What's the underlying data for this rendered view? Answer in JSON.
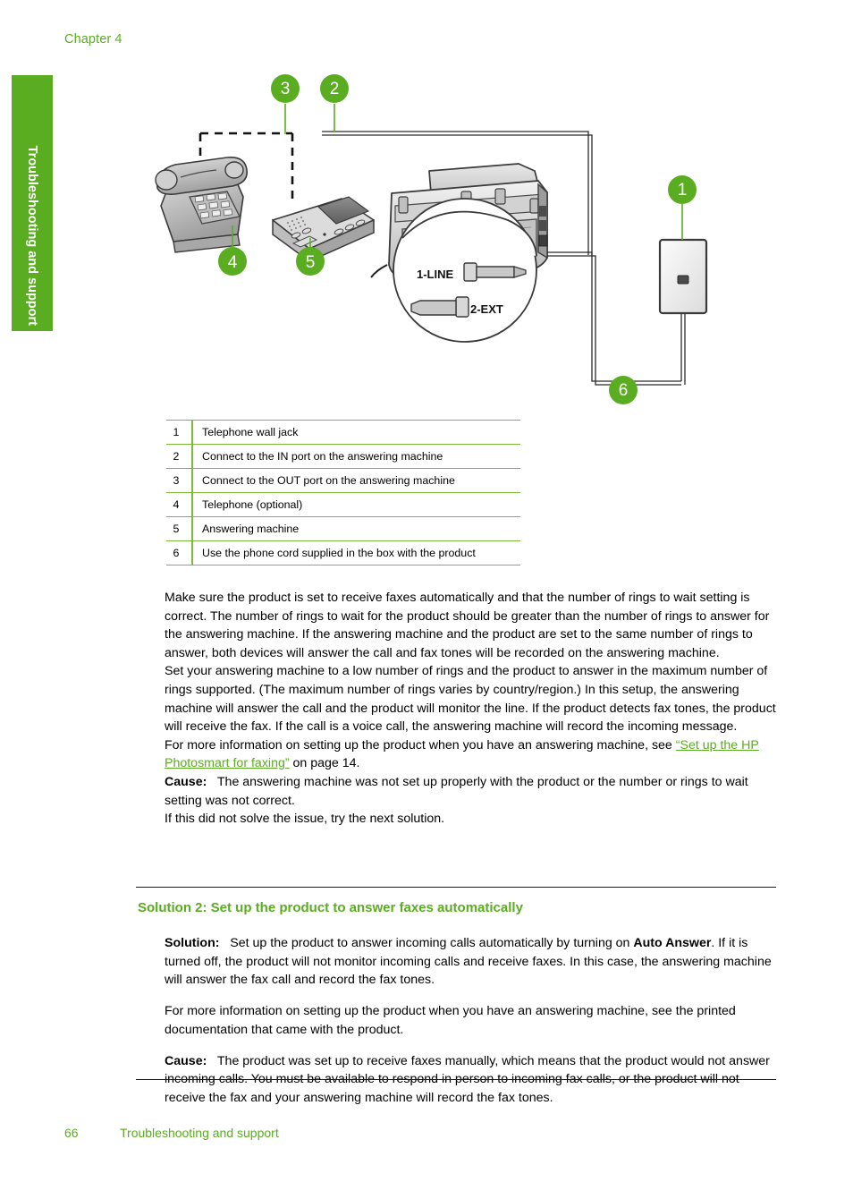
{
  "chapter": {
    "label": "Chapter 4"
  },
  "side_tab": {
    "label": "Troubleshooting and support"
  },
  "figure": {
    "callouts": [
      {
        "id": "1",
        "number": "1"
      },
      {
        "id": "2",
        "number": "2"
      },
      {
        "id": "3",
        "number": "3"
      },
      {
        "id": "4",
        "number": "4"
      },
      {
        "id": "5",
        "number": "5"
      },
      {
        "id": "6",
        "number": "6"
      }
    ],
    "port_labels": {
      "line": "1-LINE",
      "ext": "2-EXT"
    },
    "accent_color": "#5aad20"
  },
  "legend": {
    "rows": [
      {
        "num": "1",
        "text": "Telephone wall jack"
      },
      {
        "num": "2",
        "text": "Connect to the IN port on the answering machine"
      },
      {
        "num": "3",
        "text": "Connect to the OUT port on the answering machine"
      },
      {
        "num": "4",
        "text": "Telephone (optional)"
      },
      {
        "num": "5",
        "text": "Answering machine"
      },
      {
        "num": "6",
        "text": "Use the phone cord supplied in the box with the product"
      }
    ]
  },
  "body": {
    "p1": "Make sure the product is set to receive faxes automatically and that the number of rings to wait setting is correct. The number of rings to wait for the product should be greater than the number of rings to answer for the answering machine. If the answering machine and the product are set to the same number of rings to answer, both devices will answer the call and fax tones will be recorded on the answering machine.",
    "p2": "Set your answering machine to a low number of rings and the product to answer in the maximum number of rings supported. (The maximum number of rings varies by country/region.) In this setup, the answering machine will answer the call and the product will monitor the line. If the product detects fax tones, the product will receive the fax. If the call is a voice call, the answering machine will record the incoming message.",
    "p3_prefix": "For more information on setting up the product when you have an answering machine, see ",
    "p3_link": "“Set up the HP Photosmart for faxing”",
    "p3_suffix": " on page 14.",
    "cause_label": "Cause:",
    "cause_text": "The answering machine was not set up properly with the product or the number or rings to wait setting was not correct.",
    "p4": "If this did not solve the issue, try the next solution."
  },
  "solution2": {
    "heading": "Solution 2: Set up the product to answer faxes automatically",
    "solution_label": "Solution:",
    "solution_text_1": "Set up the product to answer incoming calls automatically by turning on ",
    "solution_bold": "Auto Answer",
    "solution_text_2": ". If it is turned off, the product will not monitor incoming calls and receive faxes. In this case, the answering machine will answer the fax call and record the fax tones.",
    "info_text": "For more information on setting up the product when you have an answering machine, see the printed documentation that came with the product.",
    "cause_label": "Cause:",
    "cause_text": "The product was set up to receive faxes manually, which means that the product would not answer incoming calls. You must be available to respond in person to incoming fax calls, or the product will not receive the fax and your answering machine will record the fax tones."
  },
  "footer": {
    "page_number": "66",
    "text": "Troubleshooting and support"
  }
}
